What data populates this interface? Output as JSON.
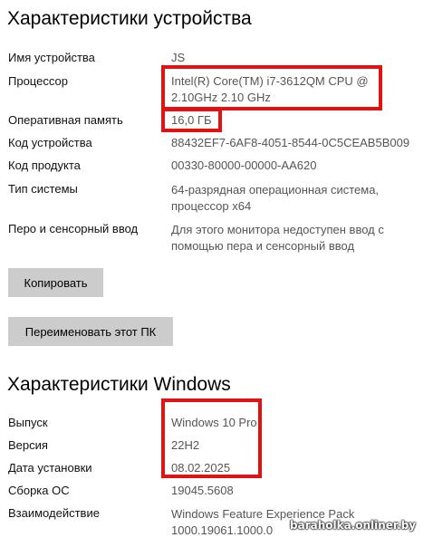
{
  "device_section": {
    "title": "Характеристики устройства",
    "rows": [
      {
        "label": "Имя устройства",
        "value": "JS"
      },
      {
        "label": "Процессор",
        "value_line1": "Intel(R) Core(TM) i7-3612QM CPU @",
        "value_line2": "2.10GHz   2.10 GHz"
      },
      {
        "label": "Оперативная память",
        "value": "16,0 ГБ"
      },
      {
        "label": "Код устройства",
        "value": "88432EF7-6AF8-4051-8544-0C5CEAB5B009"
      },
      {
        "label": "Код продукта",
        "value": "00330-80000-00000-AA620"
      },
      {
        "label": "Тип системы",
        "value_line1": "64-разрядная операционная система,",
        "value_line2": "процессор x64"
      },
      {
        "label": "Перо и сенсорный ввод",
        "value_line1": "Для этого монитора недоступен ввод с",
        "value_line2": "помощью пера и сенсорный ввод"
      }
    ],
    "copy_button": "Копировать",
    "rename_button": "Переименовать этот ПК"
  },
  "windows_section": {
    "title": "Характеристики Windows",
    "rows": [
      {
        "label": "Выпуск",
        "value": "Windows 10 Pro"
      },
      {
        "label": "Версия",
        "value": "22H2"
      },
      {
        "label": "Дата установки",
        "value": "08.02.2025"
      },
      {
        "label": "Сборка ОС",
        "value": "19045.5608"
      },
      {
        "label": "Взаимодействие",
        "value_line1": "Windows Feature Experience Pack",
        "value_line2": "1000.19061.1000.0"
      }
    ]
  },
  "watermark": "baraholka.onliner.by",
  "colors": {
    "highlight": "#e01212",
    "button": "#cccccc"
  }
}
